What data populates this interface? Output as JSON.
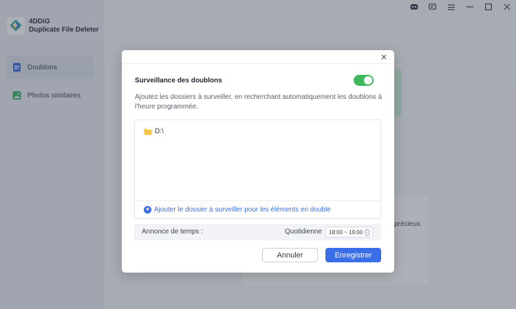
{
  "app": {
    "name_line1": "4DDiG",
    "name_line2": "Duplicate File Deleter"
  },
  "sidebar": {
    "items": [
      {
        "label": "Doublons",
        "icon": "document-icon",
        "active": true
      },
      {
        "label": "Photos similaires",
        "icon": "image-icon",
        "active": false
      }
    ]
  },
  "background": {
    "partial_text": "précieux."
  },
  "dialog": {
    "title": "Surveillance des doublons",
    "toggle_on": true,
    "description": "Ajoutez les dossiers à surveiller, en recherchant automatiquement les doublons à l'heure programmée.",
    "folders": [
      {
        "path": "D:\\"
      }
    ],
    "add_folder_label": "Ajouter le dossier à surveiller pour les éléments en double",
    "time_label": "Annonce de temps :",
    "frequency": "Quotidienne",
    "time_range": "18:00 ~ 19:00",
    "cancel_label": "Annuler",
    "save_label": "Enregistrer"
  },
  "colors": {
    "accent": "#3a6ee8",
    "toggle": "#3fb75c"
  }
}
